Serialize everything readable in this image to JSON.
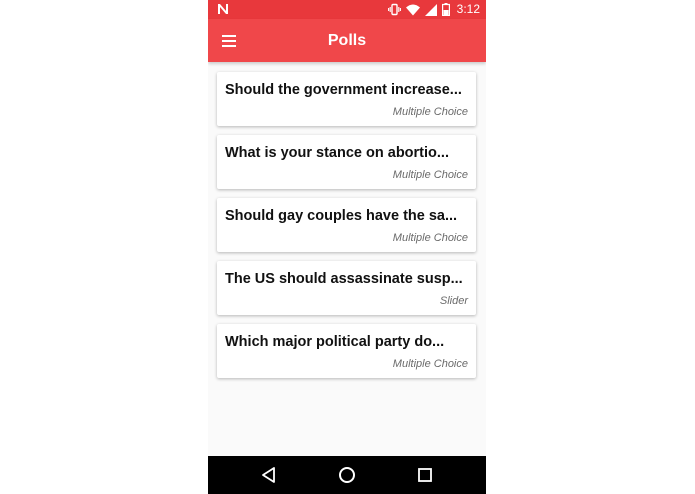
{
  "status_bar": {
    "time": "3:12",
    "icons": [
      "n-notification-icon",
      "vibrate-icon",
      "wifi-icon",
      "signal-icon",
      "battery-icon"
    ],
    "battery_level": 0.5
  },
  "app_bar": {
    "title": "Polls",
    "menu_icon": "hamburger-menu-icon"
  },
  "polls": [
    {
      "title": "Should the government increase...",
      "type": "Multiple Choice"
    },
    {
      "title": "What is your stance on abortio...",
      "type": "Multiple Choice"
    },
    {
      "title": "Should gay couples have the sa...",
      "type": "Multiple Choice"
    },
    {
      "title": "The US should assassinate susp...",
      "type": "Slider"
    },
    {
      "title": "Which major political party do...",
      "type": "Multiple Choice"
    }
  ],
  "nav_bar": {
    "icons": [
      "back-icon",
      "home-icon",
      "recents-icon"
    ]
  },
  "colors": {
    "status_bar": "#e8383c",
    "app_bar": "#f0474a",
    "background": "#fafafa",
    "nav_bar": "#000000"
  }
}
